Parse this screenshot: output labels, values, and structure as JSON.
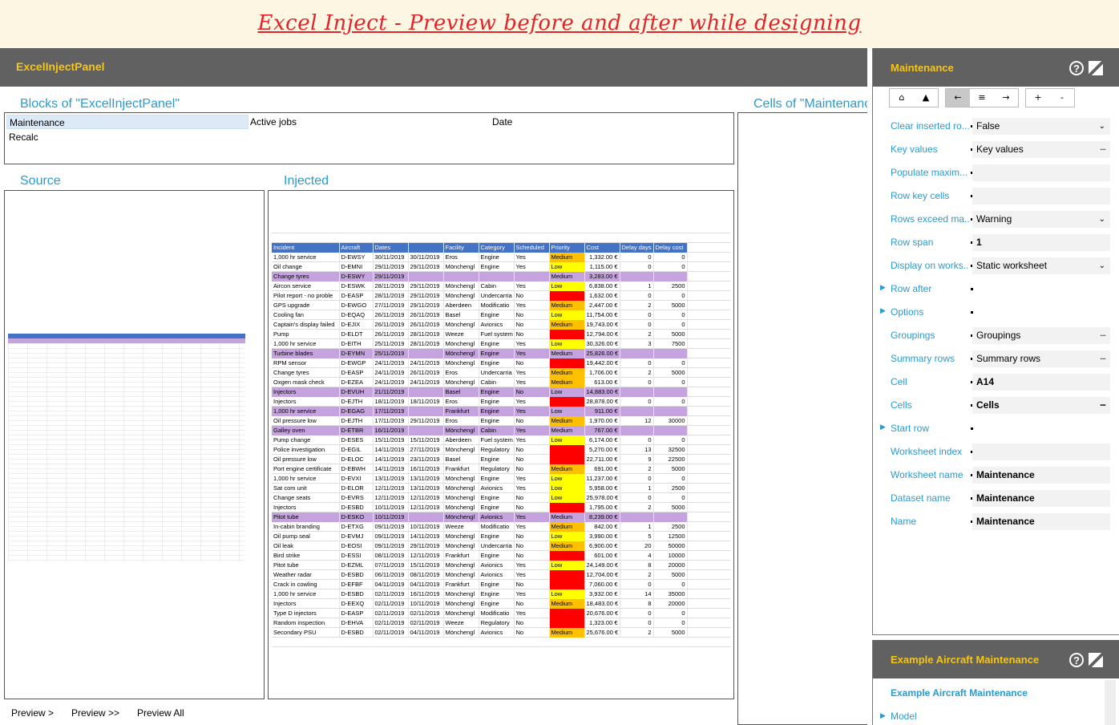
{
  "banner": {
    "title": "Excel Inject - Preview before and after while designing"
  },
  "left_panel": {
    "title": "ExcelInjectPanel",
    "blocks_heading": "Blocks of \"ExcelInjectPanel\"",
    "cells_heading": "Cells of \"Maintenance\"",
    "blocks": {
      "col1": [
        "Maintenance",
        "Recalc"
      ],
      "col2": "Active jobs",
      "col3": "Date"
    },
    "source_heading": "Source",
    "injected_heading": "Injected",
    "preview_buttons": [
      "Preview >",
      "Preview >>",
      "Preview All"
    ]
  },
  "sheet": {
    "headers": [
      "Incident",
      "Aircraft",
      "Dates",
      "",
      "Facility",
      "Category",
      "Scheduled",
      "Priority",
      "Cost",
      "Delay days",
      "Delay cost"
    ],
    "rows": [
      [
        "1,000 hr service",
        "D-EWSY",
        "30/11/2019",
        "30/11/2019",
        "Eros",
        "Engine",
        "Yes",
        "Medium",
        "1,332.00 €",
        "0",
        "0"
      ],
      [
        "Oil change",
        "D-EMNI",
        "29/11/2019",
        "29/11/2019",
        "Mönchengl",
        "Engine",
        "Yes",
        "Low",
        "1,115.00 €",
        "0",
        "0"
      ],
      [
        "Change tyres",
        "D-ESWY",
        "29/11/2019",
        "",
        "",
        "",
        "",
        "Medium",
        "3,283.00 €",
        "",
        ""
      ],
      [
        "Aircon service",
        "D-ESWK",
        "28/11/2019",
        "29/11/2019",
        "Mönchengl",
        "Cabin",
        "Yes",
        "Low",
        "6,838.00 €",
        "1",
        "2500"
      ],
      [
        "Pilot report - no proble",
        "D-EASP",
        "28/11/2019",
        "29/11/2019",
        "Mönchengl",
        "Undercarria",
        "No",
        "High",
        "1,632.00 €",
        "0",
        "0"
      ],
      [
        "GPS upgrade",
        "D-EWGO",
        "27/11/2019",
        "29/11/2019",
        "Aberdeen",
        "Modificatio",
        "Yes",
        "Medium",
        "2,447.00 €",
        "2",
        "5000"
      ],
      [
        "Cooling fan",
        "D-EQAQ",
        "26/11/2019",
        "26/11/2019",
        "Basel",
        "Engine",
        "No",
        "Low",
        "11,754.00 €",
        "0",
        "0"
      ],
      [
        "Captain's display failed",
        "D-EJIX",
        "26/11/2019",
        "26/11/2019",
        "Mönchengl",
        "Avionics",
        "No",
        "Medium",
        "19,743.00 €",
        "0",
        "0"
      ],
      [
        "Pump",
        "D-ELDT",
        "26/11/2019",
        "28/11/2019",
        "Weeze",
        "Fuel system",
        "No",
        "High",
        "12,794.00 €",
        "2",
        "5000"
      ],
      [
        "1,000 hr service",
        "D-EITH",
        "25/11/2019",
        "28/11/2019",
        "Mönchengl",
        "Engine",
        "Yes",
        "Low",
        "30,326.00 €",
        "3",
        "7500"
      ],
      [
        "Turbine blades",
        "D-EYMN",
        "25/11/2019",
        "",
        "Mönchengl",
        "Engine",
        "Yes",
        "Medium",
        "25,826.00 €",
        "",
        ""
      ],
      [
        "RPM sensor",
        "D-EWGP",
        "24/11/2019",
        "24/11/2019",
        "Mönchengl",
        "Engine",
        "No",
        "High",
        "19,442.00 €",
        "0",
        "0"
      ],
      [
        "Change tyres",
        "D-EASP",
        "24/11/2019",
        "26/11/2019",
        "Eros",
        "Undercarria",
        "Yes",
        "Medium",
        "1,706.00 €",
        "2",
        "5000"
      ],
      [
        "Oxgen mask check",
        "D-EZEA",
        "24/11/2019",
        "24/11/2019",
        "Mönchengl",
        "Cabin",
        "Yes",
        "Medium",
        "613.00 €",
        "0",
        "0"
      ],
      [
        "Injectors",
        "D-EVUH",
        "21/11/2019",
        "",
        "Basel",
        "Engine",
        "No",
        "Low",
        "14,883.00 €",
        "",
        ""
      ],
      [
        "Injectors",
        "D-EJTH",
        "18/11/2019",
        "18/11/2019",
        "Eros",
        "Engine",
        "Yes",
        "High",
        "28,878.00 €",
        "0",
        "0"
      ],
      [
        "1,000 hr service",
        "D-EGAG",
        "17/11/2019",
        "",
        "Frankfurt",
        "Engine",
        "Yes",
        "Low",
        "911.00 €",
        "",
        ""
      ],
      [
        "Oil pressure low",
        "D-EJTH",
        "17/11/2019",
        "29/11/2019",
        "Eros",
        "Engine",
        "No",
        "Medium",
        "1,970.00 €",
        "12",
        "30000"
      ],
      [
        "Galley oven",
        "D-ETBR",
        "16/11/2019",
        "",
        "Mönchengl",
        "Cabin",
        "Yes",
        "Medium",
        "767.00 €",
        "",
        ""
      ],
      [
        "Pump change",
        "D-ESES",
        "15/11/2019",
        "15/11/2019",
        "Aberdeen",
        "Fuel system",
        "Yes",
        "Low",
        "6,174.00 €",
        "0",
        "0"
      ],
      [
        "Police investigation",
        "D-EGIL",
        "14/11/2019",
        "27/11/2019",
        "Mönchengl",
        "Regulatory",
        "No",
        "High",
        "5,270.00 €",
        "13",
        "32500"
      ],
      [
        "Oil pressure low",
        "D-ELOC",
        "14/11/2019",
        "23/11/2019",
        "Basel",
        "Engine",
        "No",
        "High",
        "22,711.00 €",
        "9",
        "22500"
      ],
      [
        "Port engine certificate",
        "D-EBWH",
        "14/11/2019",
        "16/11/2019",
        "Frankfurt",
        "Regulatory",
        "No",
        "Medium",
        "691.00 €",
        "2",
        "5000"
      ],
      [
        "1,000 hr service",
        "D-EVXI",
        "13/11/2019",
        "13/11/2019",
        "Mönchengl",
        "Engine",
        "Yes",
        "Low",
        "11,237.00 €",
        "0",
        "0"
      ],
      [
        "Sat com unit",
        "D-ELOR",
        "12/11/2019",
        "13/11/2019",
        "Mönchengl",
        "Avionics",
        "Yes",
        "Low",
        "5,958.00 €",
        "1",
        "2500"
      ],
      [
        "Change seats",
        "D-EVRS",
        "12/11/2019",
        "12/11/2019",
        "Mönchengl",
        "Engine",
        "No",
        "Low",
        "25,978.00 €",
        "0",
        "0"
      ],
      [
        "Injectors",
        "D-ESBD",
        "10/11/2019",
        "12/11/2019",
        "Mönchengl",
        "Engine",
        "No",
        "High",
        "1,795.00 €",
        "2",
        "5000"
      ],
      [
        "Pitot tube",
        "D-ESKO",
        "10/11/2019",
        "",
        "Mönchengl",
        "Avionics",
        "Yes",
        "Medium",
        "8,239.00 €",
        "",
        ""
      ],
      [
        "In-cabin branding",
        "D-ETXG",
        "09/11/2019",
        "10/11/2019",
        "Weeze",
        "Modificatio",
        "Yes",
        "Medium",
        "842.00 €",
        "1",
        "2500"
      ],
      [
        "Oil pump seal",
        "D-EVMJ",
        "09/11/2019",
        "14/11/2019",
        "Mönchengl",
        "Engine",
        "No",
        "Low",
        "3,990.00 €",
        "5",
        "12500"
      ],
      [
        "Oil leak",
        "D-EOSI",
        "09/11/2019",
        "29/11/2019",
        "Mönchengl",
        "Undercarria",
        "No",
        "Medium",
        "6,900.00 €",
        "20",
        "50000"
      ],
      [
        "Bird strike",
        "D-ESSI",
        "08/11/2019",
        "12/11/2019",
        "Frankfurt",
        "Engine",
        "No",
        "High",
        "601.00 €",
        "4",
        "10000"
      ],
      [
        "Pitot tube",
        "D-EZML",
        "07/11/2019",
        "15/11/2019",
        "Mönchengl",
        "Avionics",
        "Yes",
        "Low",
        "24,149.00 €",
        "8",
        "20000"
      ],
      [
        "Weather radar",
        "D-ESBD",
        "06/11/2019",
        "08/11/2019",
        "Mönchengl",
        "Avionics",
        "Yes",
        "High",
        "12,704.00 €",
        "2",
        "5000"
      ],
      [
        "Crack in cowling",
        "D-EFBF",
        "04/11/2019",
        "04/11/2019",
        "Frankfurt",
        "Engine",
        "No",
        "High",
        "7,060.00 €",
        "0",
        "0"
      ],
      [
        "1,000 hr service",
        "D-ESBD",
        "02/11/2019",
        "16/11/2019",
        "Mönchengl",
        "Engine",
        "Yes",
        "Low",
        "3,932.00 €",
        "14",
        "35000"
      ],
      [
        "Injectors",
        "D-EEXQ",
        "02/11/2019",
        "10/11/2019",
        "Mönchengl",
        "Engine",
        "No",
        "Medium",
        "18,483.00 €",
        "8",
        "20000"
      ],
      [
        "Type D injectors",
        "D-EASP",
        "02/11/2019",
        "02/11/2019",
        "Mönchengl",
        "Modificatio",
        "Yes",
        "High",
        "20,676.00 €",
        "0",
        "0"
      ],
      [
        "Random inspection",
        "D-EHVA",
        "02/11/2019",
        "02/11/2019",
        "Weeze",
        "Regulatory",
        "No",
        "High",
        "1,323.00 €",
        "0",
        "0"
      ],
      [
        "Secondary PSU",
        "D-ESBD",
        "02/11/2019",
        "04/11/2019",
        "Mönchengl",
        "Avionics",
        "No",
        "Medium",
        "25,676.00 €",
        "2",
        "5000"
      ]
    ],
    "group_rows": [
      2,
      10,
      14,
      16,
      18,
      27
    ]
  },
  "right_panel": {
    "title": "Maintenance",
    "toolbar": [
      "⌂",
      "▲",
      "←",
      "≡",
      "→",
      "+",
      "-"
    ],
    "properties": [
      {
        "label": "Clear inserted ro...",
        "value": "False",
        "kind": "dropdown"
      },
      {
        "label": "Key values",
        "value": "Key values",
        "kind": "ellipsis"
      },
      {
        "label": "Populate maxim...",
        "value": "",
        "kind": "plain"
      },
      {
        "label": "Row key cells",
        "value": "",
        "kind": "plain"
      },
      {
        "label": "Rows exceed ma...",
        "value": "Warning",
        "kind": "dropdown"
      },
      {
        "label": "Row span",
        "value": "1",
        "kind": "bold"
      },
      {
        "label": "Display on works...",
        "value": "Static worksheet",
        "kind": "dropdown"
      },
      {
        "label": "Row after",
        "value": "",
        "kind": "expand"
      },
      {
        "label": "Options",
        "value": "",
        "kind": "expand"
      },
      {
        "label": "Groupings",
        "value": "Groupings",
        "kind": "ellipsis"
      },
      {
        "label": "Summary rows",
        "value": "Summary rows",
        "kind": "ellipsis"
      },
      {
        "label": "Cell",
        "value": "A14",
        "kind": "bold"
      },
      {
        "label": "Cells",
        "value": "Cells",
        "kind": "boldellipsis"
      },
      {
        "label": "Start row",
        "value": "",
        "kind": "expand"
      },
      {
        "label": "Worksheet index",
        "value": "",
        "kind": "plain"
      },
      {
        "label": "Worksheet name",
        "value": "Maintenance",
        "kind": "bold"
      },
      {
        "label": "Dataset name",
        "value": "Maintenance",
        "kind": "bold"
      },
      {
        "label": "Name",
        "value": "Maintenance",
        "kind": "bold"
      }
    ]
  },
  "right_panel2": {
    "title": "Example Aircraft Maintenance",
    "link": "Example Aircraft Maintenance",
    "model": "Model"
  },
  "colors": {
    "accent": "#2a9bd0",
    "header_bg": "#616161",
    "title_yellow": "#f5c518",
    "banner_red": "#e0242a"
  },
  "icons": [
    "help-icon",
    "pin-icon",
    "expand-arrow-icon",
    "dropdown-chevron-icon"
  ]
}
